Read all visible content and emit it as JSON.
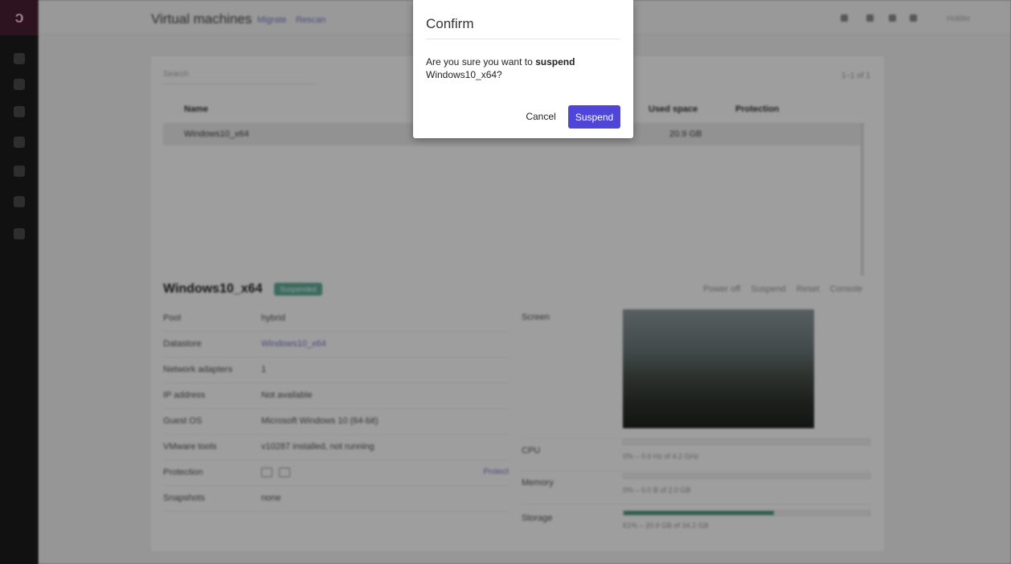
{
  "app": {
    "brand_glyph": "ↄ",
    "page_title": "Virtual machines",
    "header_links": [
      "Migrate",
      "Rescan"
    ],
    "user": "Holder",
    "search_placeholder": "Search",
    "pager": "1–1 of 1",
    "table": {
      "columns": [
        "Name",
        "Used space",
        "Protection"
      ],
      "rows": [
        {
          "name": "Windows10_x64",
          "used_space": "20.9 GB"
        }
      ]
    },
    "vm": {
      "name": "Windows10_x64",
      "status": "Suspended",
      "actions": [
        "Power off",
        "Suspend",
        "Reset",
        "Console"
      ],
      "properties": [
        {
          "key": "Pool",
          "value": "hybrid"
        },
        {
          "key": "Datastore",
          "value": "Windows10_x64"
        },
        {
          "key": "Network adapters",
          "value": "1"
        },
        {
          "key": "IP address",
          "value": "Not available"
        },
        {
          "key": "Guest OS",
          "value": "Microsoft Windows 10 (64-bit)"
        },
        {
          "key": "VMware tools",
          "value": "v10287 installed, not running"
        },
        {
          "key": "Protection",
          "value": "",
          "action": "Protect"
        },
        {
          "key": "Snapshots",
          "value": "none"
        }
      ],
      "stats_labels": [
        "Screen",
        "CPU",
        "Memory",
        "Storage"
      ],
      "cpu": {
        "text": "0% – 0.0 Hz of 4.2 GHz",
        "fraction": 0.0
      },
      "memory": {
        "text": "0% – 0.0 B of 2.0 GB",
        "fraction": 0.0
      },
      "storage": {
        "text": "61% – 20.9 GB of 34.2 GB",
        "fraction": 0.61
      }
    }
  },
  "dialog": {
    "title": "Confirm",
    "message_prefix": "Are you sure you want to ",
    "message_action": "suspend",
    "message_target": "Windows10_x64?",
    "cancel_label": "Cancel",
    "confirm_label": "Suspend",
    "confirm_color": "#4f46d9"
  }
}
